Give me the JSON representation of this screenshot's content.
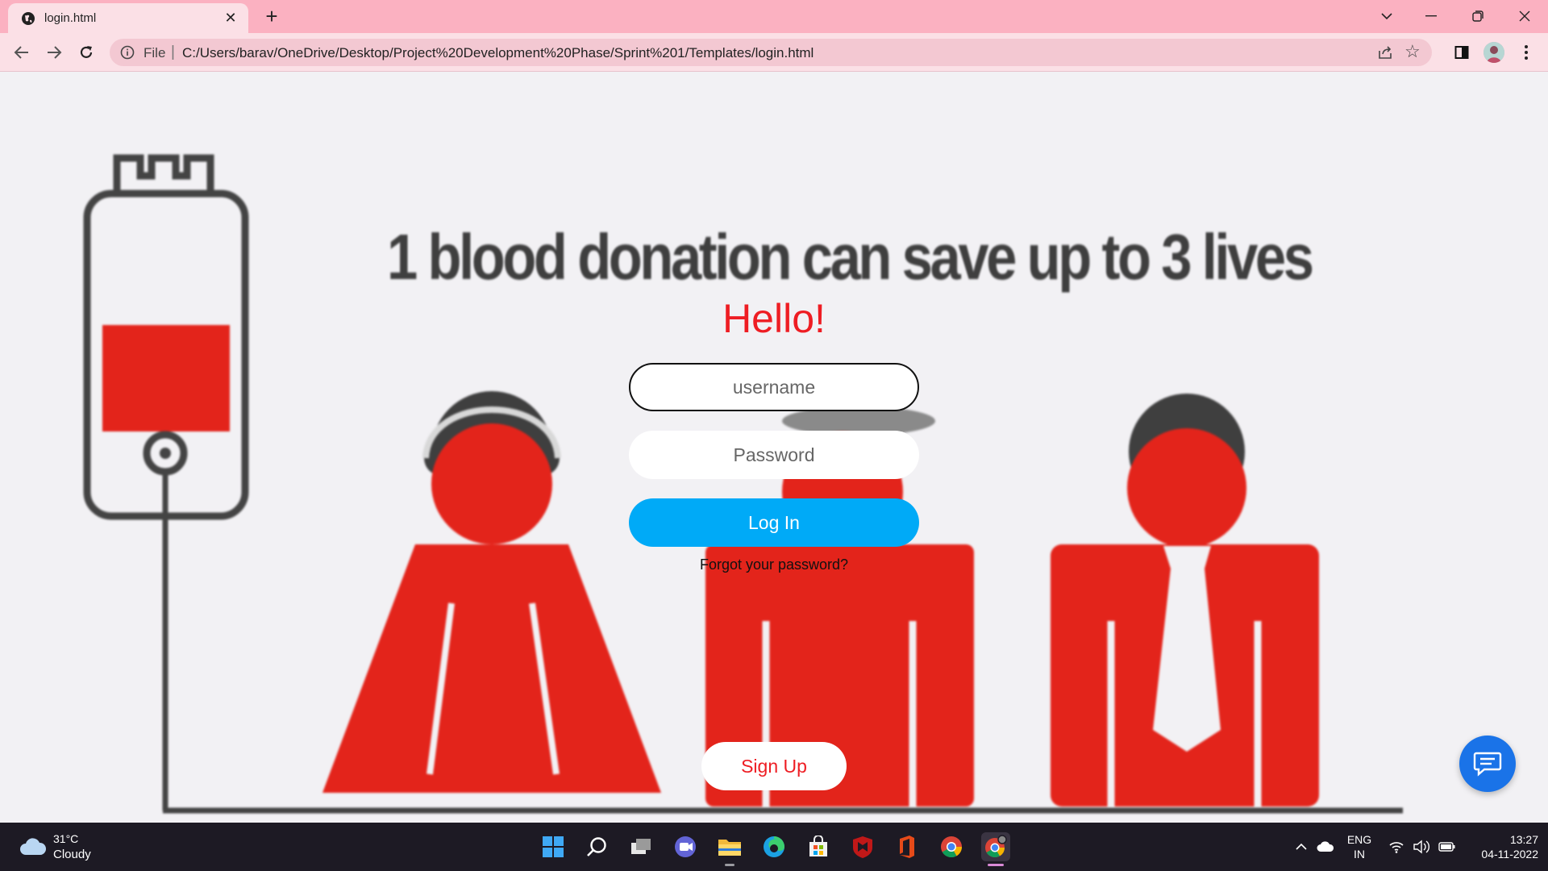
{
  "browser": {
    "tab_title": "login.html",
    "new_tab_symbol": "+",
    "close_symbol": "✕",
    "omnibox": {
      "scheme_label": "File",
      "separator": "|",
      "url": "C:/Users/barav/OneDrive/Desktop/Project%20Development%20Phase/Sprint%201/Templates/login.html"
    },
    "icons": [
      "globe-icon",
      "back-icon",
      "forward-icon",
      "reload-icon",
      "info-icon",
      "share-icon",
      "star-icon",
      "side-panel-icon",
      "profile-avatar",
      "kebab-menu-icon",
      "tab-search-icon",
      "minimize-icon",
      "restore-icon",
      "close-icon"
    ]
  },
  "page": {
    "headline": "1 blood donation can save up to 3 lives",
    "greeting": "Hello!",
    "username_placeholder": "username",
    "password_placeholder": "Password",
    "login_label": "Log In",
    "forgot_label": "Forgot your password?",
    "signup_label": "Sign Up",
    "colors": {
      "accent_red": "#ee1d23",
      "button_blue": "#00aaf7",
      "chat_blue": "#1a73e8",
      "figure_red": "#e3241b",
      "outline_gray": "#444444"
    }
  },
  "taskbar": {
    "weather": {
      "temp": "31°C",
      "condition": "Cloudy"
    },
    "apps": [
      "start-icon",
      "search-icon",
      "task-view-icon",
      "teams-chat-icon",
      "file-explorer-icon",
      "edge-icon",
      "store-icon",
      "mcafee-icon",
      "office-icon",
      "chrome-icon",
      "chrome-canary-icon"
    ],
    "language": {
      "line1": "ENG",
      "line2": "IN"
    },
    "clock": {
      "time": "13:27",
      "date": "04-11-2022"
    }
  }
}
